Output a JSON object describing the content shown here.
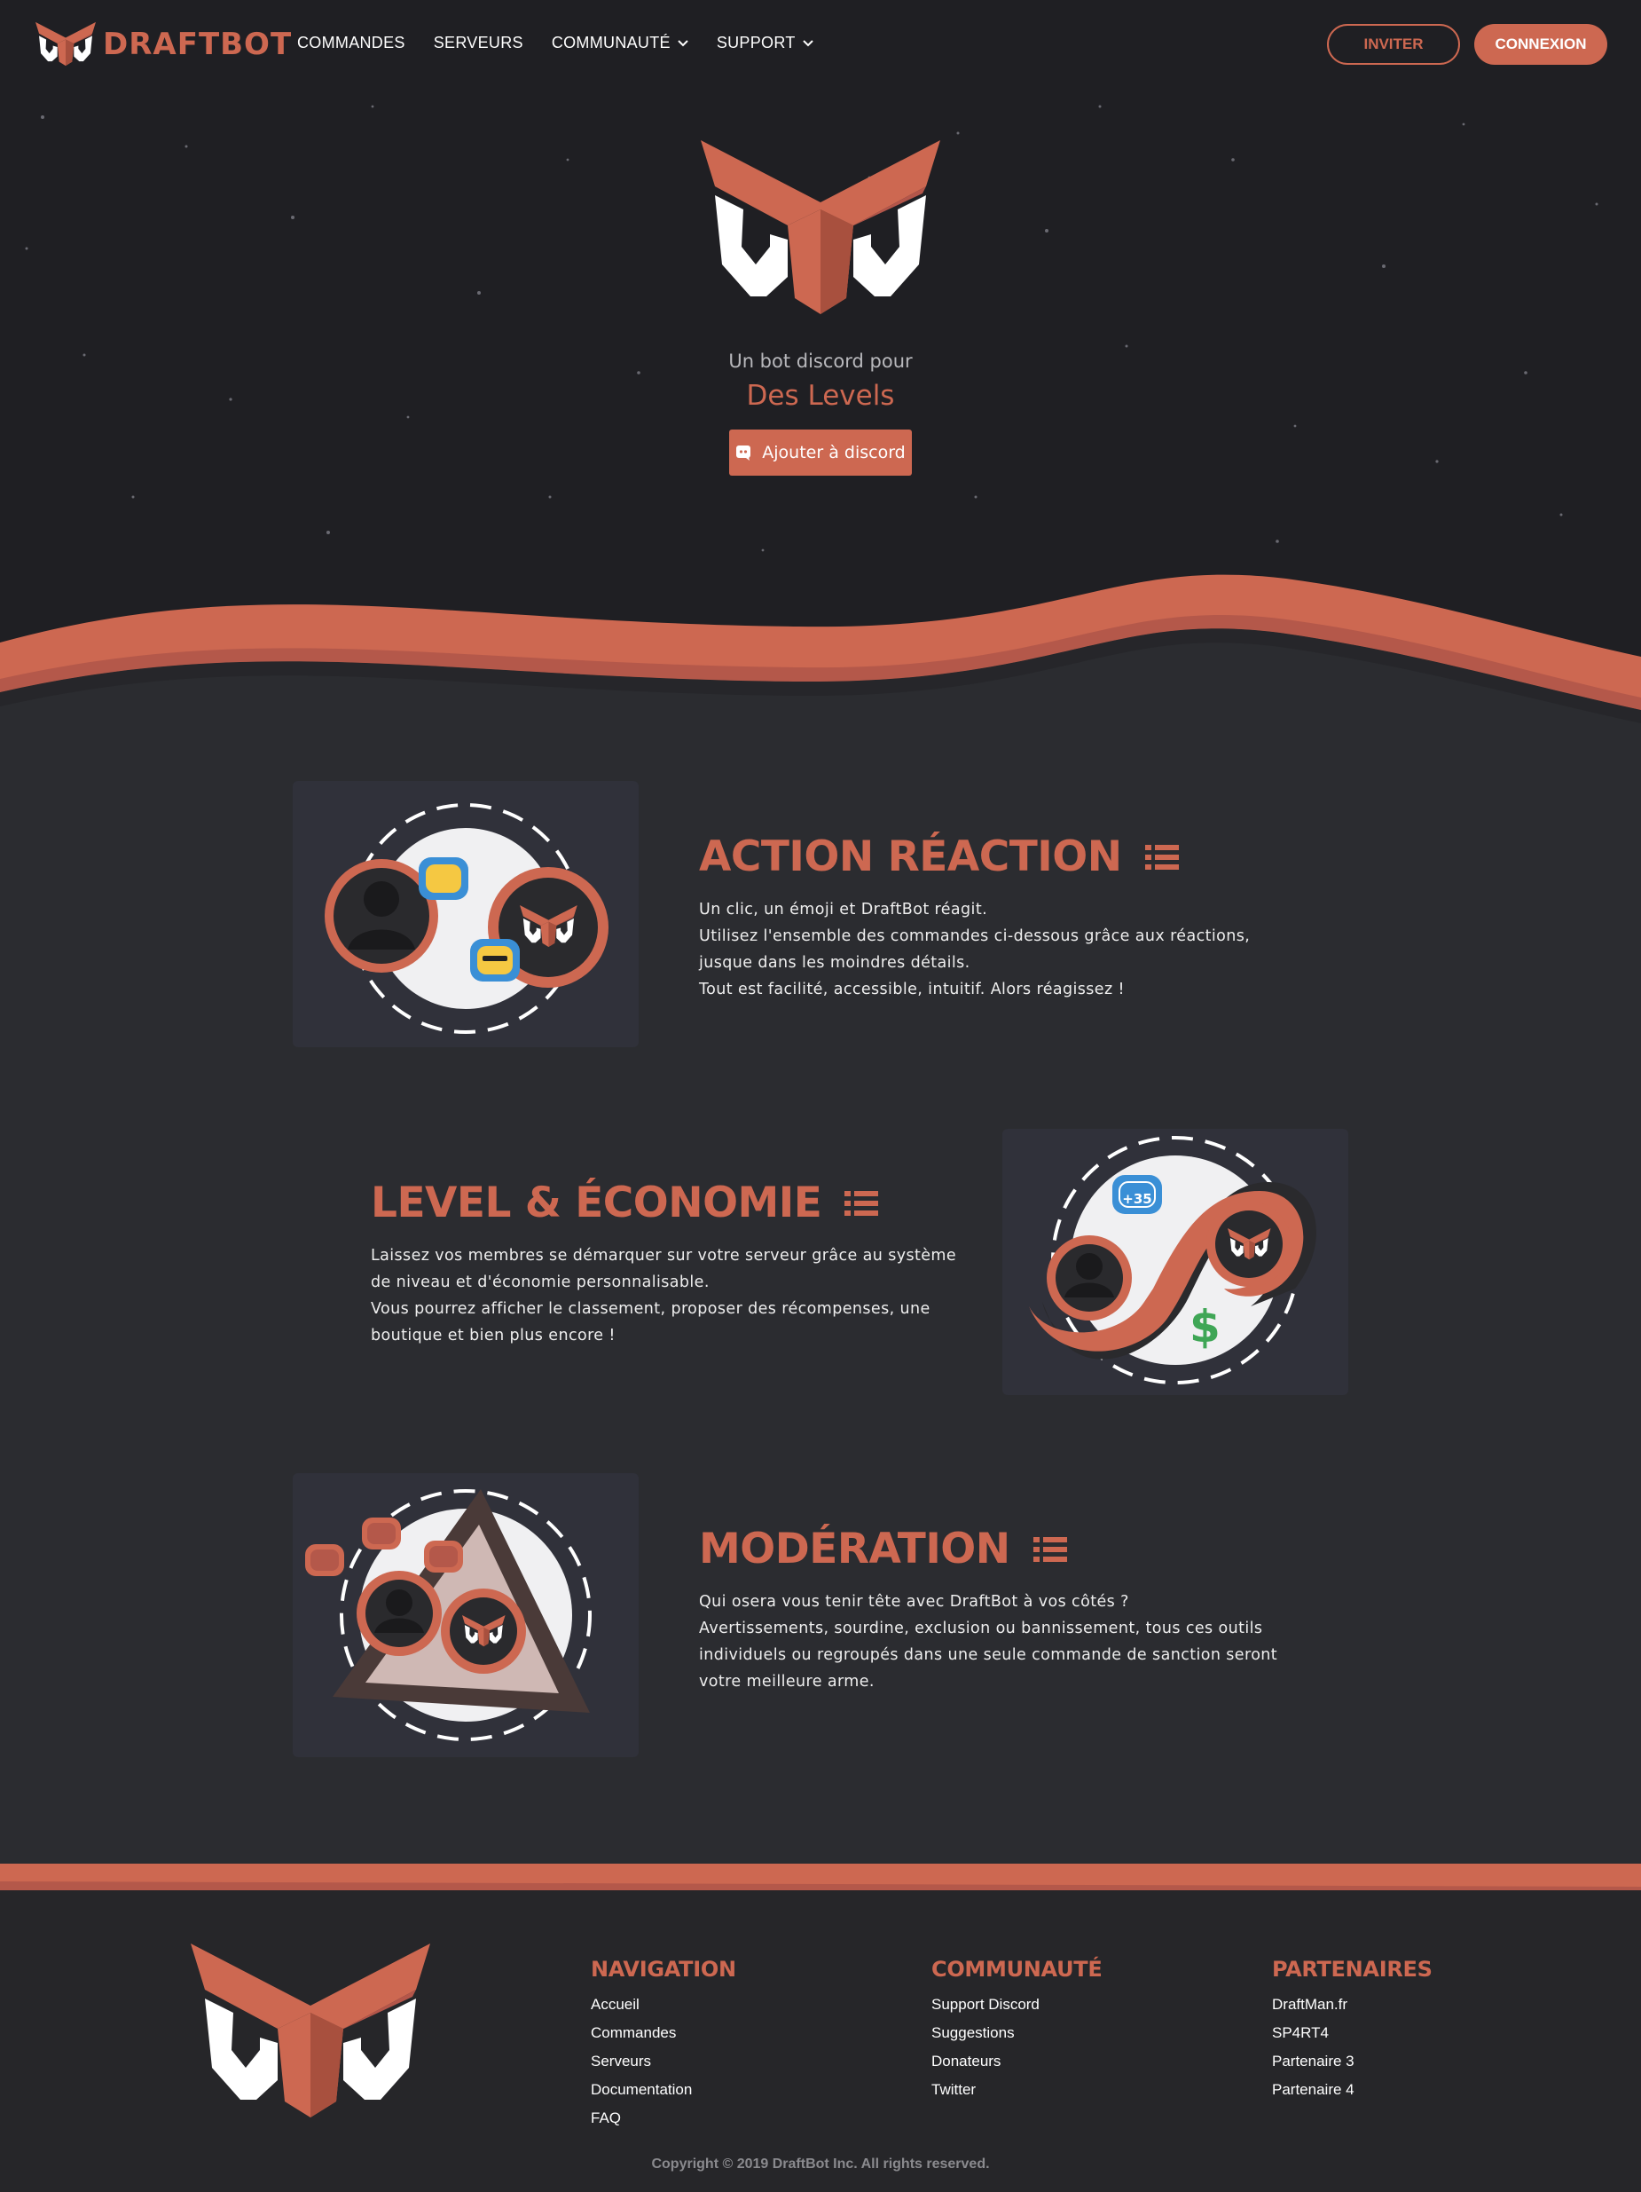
{
  "colors": {
    "accent": "#cd6851",
    "hero_bg": "#1f1f23",
    "body_bg": "#2b2c30",
    "footer_bg": "#262629"
  },
  "navbar": {
    "brand": "DRAFTBOT",
    "links": [
      {
        "label": "COMMANDES",
        "dropdown": false
      },
      {
        "label": "SERVEURS",
        "dropdown": false
      },
      {
        "label": "COMMUNAUTÉ",
        "dropdown": true
      },
      {
        "label": "SUPPORT",
        "dropdown": true
      }
    ],
    "invite_label": "INVITER",
    "login_label": "CONNEXION"
  },
  "hero": {
    "tagline": "Un bot discord pour",
    "rotating_text": "Des Levels",
    "add_button": "Ajouter à discord"
  },
  "features": [
    {
      "title": "ACTION RÉACTION",
      "lines": [
        "Un clic, un émoji et DraftBot réagit.",
        "Utilisez l'ensemble des commandes ci-dessous grâce aux réactions,",
        "jusque dans les moindres détails.",
        "Tout est facilité, accessible, intuitif. Alors réagissez !"
      ]
    },
    {
      "title": "LEVEL & ÉCONOMIE",
      "badge": "+35",
      "lines": [
        "Laissez vos membres se démarquer sur votre serveur grâce au système",
        "de niveau et d'économie personnalisable.",
        "Vous pourrez afficher le classement, proposer des récompenses, une",
        "boutique et bien plus encore !"
      ]
    },
    {
      "title": "MODÉRATION",
      "lines": [
        "Qui osera vous tenir tête avec DraftBot à vos côtés ?",
        "Avertissements, sourdine, exclusion ou bannissement, tous ces outils",
        "individuels ou regroupés dans une seule commande de sanction seront",
        "votre meilleure arme."
      ]
    }
  ],
  "footer": {
    "columns": [
      {
        "title": "NAVIGATION",
        "items": [
          "Accueil",
          "Commandes",
          "Serveurs",
          "Documentation",
          "FAQ"
        ]
      },
      {
        "title": "COMMUNAUTÉ",
        "items": [
          "Support Discord",
          "Suggestions",
          "Donateurs",
          "Twitter"
        ]
      },
      {
        "title": "PARTENAIRES",
        "items": [
          "DraftMan.fr",
          "SP4RT4",
          "Partenaire 3",
          "Partenaire 4"
        ]
      }
    ],
    "copyright": "Copyright © 2019 DraftBot Inc.  All rights reserved."
  }
}
